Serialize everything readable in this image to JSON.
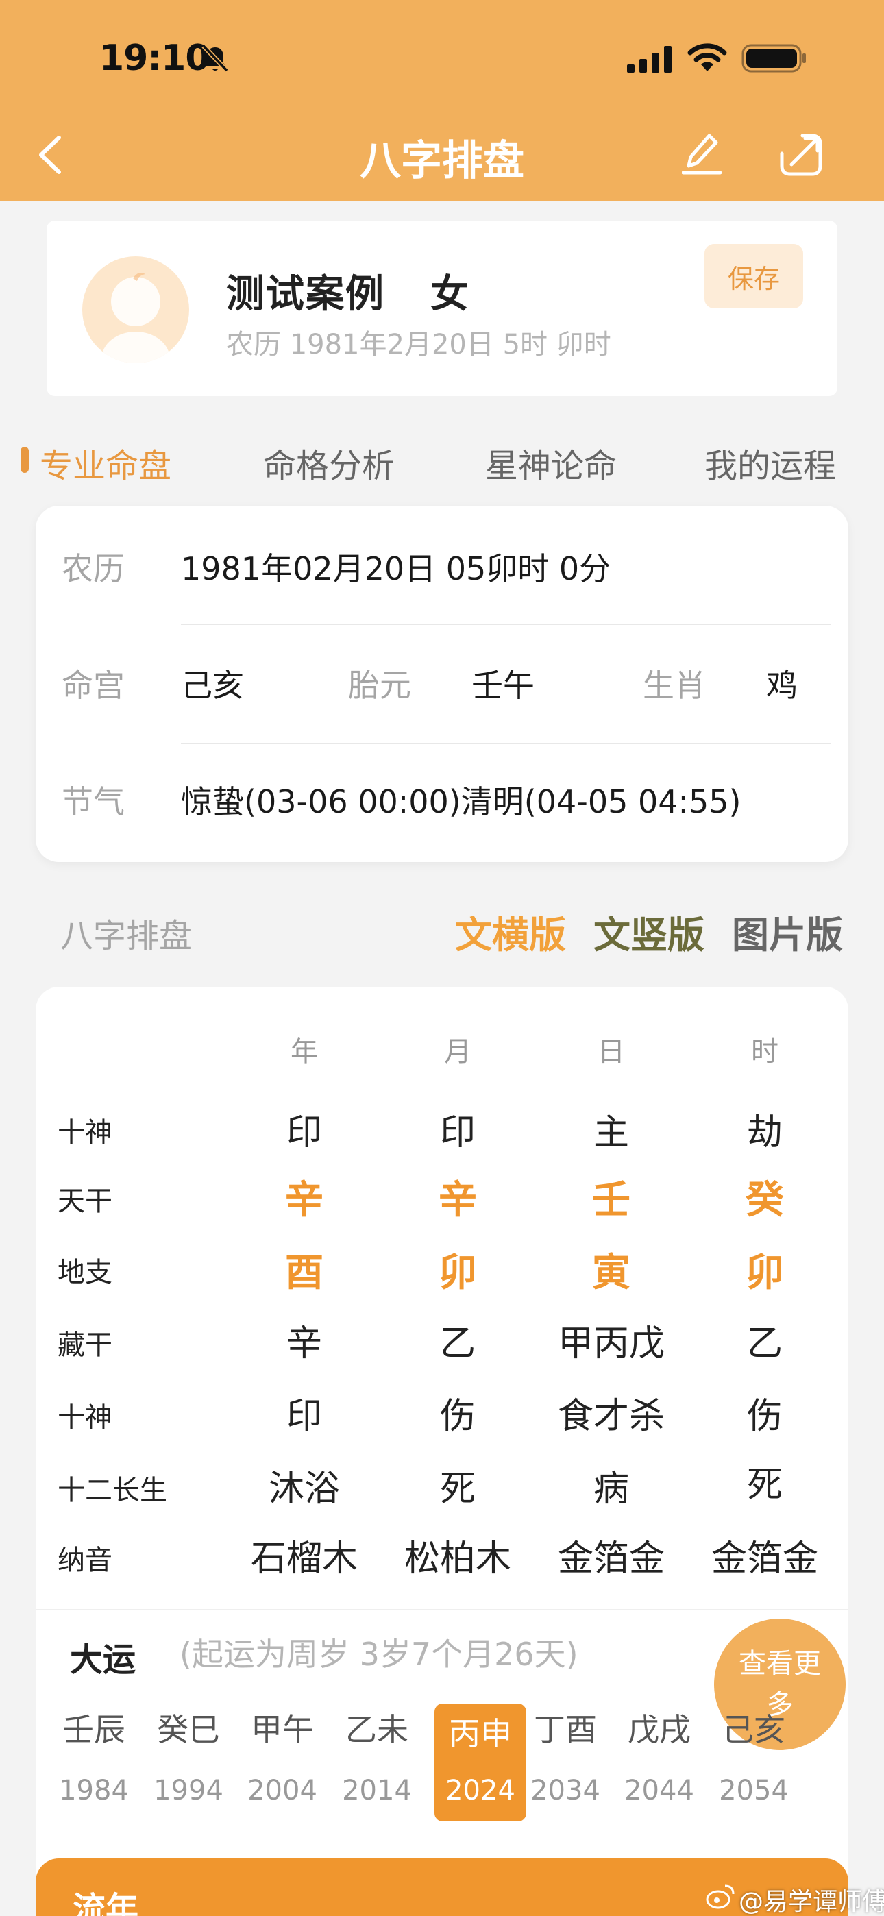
{
  "status_bar": {
    "time": "19:10"
  },
  "nav": {
    "title": "八字排盘"
  },
  "profile": {
    "name": "测试案例",
    "gender": "女",
    "date": "农历 1981年2月20日 5时 卯时",
    "save_label": "保存"
  },
  "tabs": [
    {
      "label": "专业命盘",
      "active": true
    },
    {
      "label": "命格分析",
      "active": false
    },
    {
      "label": "星神论命",
      "active": false
    },
    {
      "label": "我的运程",
      "active": false
    }
  ],
  "info": {
    "lunar_label": "农历",
    "lunar_value": "1981年02月20日 05卯时 0分",
    "minggong_label": "命宫",
    "minggong_value": "己亥",
    "taiyuan_label": "胎元",
    "taiyuan_value": "壬午",
    "shengxiao_label": "生肖",
    "shengxiao_value": "鸡",
    "jieqi_label": "节气",
    "jieqi_value": "惊蛰(03-06 00:00)清明(04-05 04:55)"
  },
  "section": {
    "title": "八字排盘",
    "versions": [
      {
        "label": "文横版",
        "color": "#f2a13a"
      },
      {
        "label": "文竖版",
        "color": "#6b6b3a"
      },
      {
        "label": "图片版",
        "color": "#666666"
      }
    ]
  },
  "chart_table": {
    "columns": [
      "年",
      "月",
      "日",
      "时"
    ],
    "rows": [
      {
        "label": "十神",
        "cells": [
          "印",
          "印",
          "主",
          "劫"
        ],
        "highlight": false
      },
      {
        "label": "天干",
        "cells": [
          "辛",
          "辛",
          "壬",
          "癸"
        ],
        "highlight": true
      },
      {
        "label": "地支",
        "cells": [
          "酉",
          "卯",
          "寅",
          "卯"
        ],
        "highlight": true
      },
      {
        "label": "藏干",
        "cells": [
          "辛",
          "乙",
          "甲丙戊",
          "乙"
        ],
        "highlight": false
      },
      {
        "label": "十神",
        "cells": [
          "印",
          "伤",
          "食才杀",
          "伤"
        ],
        "highlight": false
      },
      {
        "label": "十二长生",
        "cells": [
          "沐浴",
          "死",
          "病",
          "死"
        ],
        "highlight": false
      },
      {
        "label": "纳音",
        "cells": [
          "石榴木",
          "松柏木",
          "金箔金",
          "金箔金"
        ],
        "highlight": false
      }
    ]
  },
  "dayun": {
    "title": "大运",
    "note": "(起运为周岁 3岁7个月26天)",
    "more_label": "查看更多",
    "items": [
      {
        "gz": "壬辰",
        "year": "1984",
        "active": false
      },
      {
        "gz": "癸巳",
        "year": "1994",
        "active": false
      },
      {
        "gz": "甲午",
        "year": "2004",
        "active": false
      },
      {
        "gz": "乙未",
        "year": "2014",
        "active": false
      },
      {
        "gz": "丙申",
        "year": "2024",
        "active": true
      },
      {
        "gz": "丁酉",
        "year": "2034",
        "active": false
      },
      {
        "gz": "戊戌",
        "year": "2044",
        "active": false
      },
      {
        "gz": "己亥",
        "year": "2054",
        "active": false
      }
    ]
  },
  "liunian": {
    "label": "流年"
  },
  "watermark": "@易学谭师傅",
  "colors": {
    "header": "#f2b05c",
    "accent": "#f0962e",
    "muted": "#a5a5a5"
  }
}
